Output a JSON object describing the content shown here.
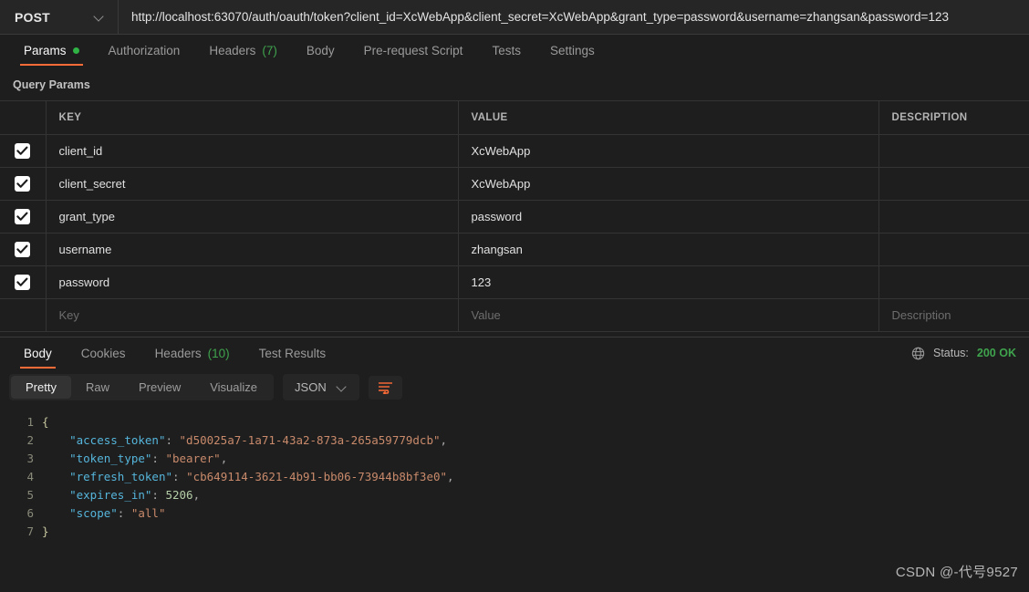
{
  "urlbar": {
    "method": "POST",
    "url": "http://localhost:63070/auth/oauth/token?client_id=XcWebApp&client_secret=XcWebApp&grant_type=password&username=zhangsan&password=123"
  },
  "request_tabs": [
    {
      "label": "Params",
      "badge": "",
      "active": true,
      "dot": true
    },
    {
      "label": "Authorization",
      "badge": "",
      "active": false,
      "dot": false
    },
    {
      "label": "Headers",
      "badge": "(7)",
      "active": false,
      "dot": false
    },
    {
      "label": "Body",
      "badge": "",
      "active": false,
      "dot": false
    },
    {
      "label": "Pre-request Script",
      "badge": "",
      "active": false,
      "dot": false
    },
    {
      "label": "Tests",
      "badge": "",
      "active": false,
      "dot": false
    },
    {
      "label": "Settings",
      "badge": "",
      "active": false,
      "dot": false
    }
  ],
  "query_params": {
    "section_title": "Query Params",
    "columns": [
      "KEY",
      "VALUE",
      "DESCRIPTION"
    ],
    "rows": [
      {
        "checked": true,
        "key": "client_id",
        "value": "XcWebApp",
        "description": ""
      },
      {
        "checked": true,
        "key": "client_secret",
        "value": "XcWebApp",
        "description": ""
      },
      {
        "checked": true,
        "key": "grant_type",
        "value": "password",
        "description": ""
      },
      {
        "checked": true,
        "key": "username",
        "value": "zhangsan",
        "description": ""
      },
      {
        "checked": true,
        "key": "password",
        "value": "123",
        "description": ""
      }
    ],
    "placeholder_row": {
      "key": "Key",
      "value": "Value",
      "description": "Description"
    }
  },
  "response": {
    "tabs": [
      {
        "label": "Body",
        "badge": "",
        "active": true
      },
      {
        "label": "Cookies",
        "badge": "",
        "active": false
      },
      {
        "label": "Headers",
        "badge": "(10)",
        "active": false
      },
      {
        "label": "Test Results",
        "badge": "",
        "active": false
      }
    ],
    "status_label": "Status:",
    "status_value": "200 OK",
    "status_color": "#3fa34d",
    "format_tabs": [
      {
        "label": "Pretty",
        "active": true
      },
      {
        "label": "Raw",
        "active": false
      },
      {
        "label": "Preview",
        "active": false
      },
      {
        "label": "Visualize",
        "active": false
      }
    ],
    "language": "JSON",
    "body_lines": [
      {
        "n": "1",
        "segments": [
          {
            "t": "{",
            "c": "brace"
          }
        ]
      },
      {
        "n": "2",
        "segments": [
          {
            "t": "    ",
            "c": "punc"
          },
          {
            "t": "\"access_token\"",
            "c": "key"
          },
          {
            "t": ": ",
            "c": "punc"
          },
          {
            "t": "\"d50025a7-1a71-43a2-873a-265a59779dcb\"",
            "c": "str"
          },
          {
            "t": ",",
            "c": "punc"
          }
        ]
      },
      {
        "n": "3",
        "segments": [
          {
            "t": "    ",
            "c": "punc"
          },
          {
            "t": "\"token_type\"",
            "c": "key"
          },
          {
            "t": ": ",
            "c": "punc"
          },
          {
            "t": "\"bearer\"",
            "c": "str"
          },
          {
            "t": ",",
            "c": "punc"
          }
        ]
      },
      {
        "n": "4",
        "segments": [
          {
            "t": "    ",
            "c": "punc"
          },
          {
            "t": "\"refresh_token\"",
            "c": "key"
          },
          {
            "t": ": ",
            "c": "punc"
          },
          {
            "t": "\"cb649114-3621-4b91-bb06-73944b8bf3e0\"",
            "c": "str"
          },
          {
            "t": ",",
            "c": "punc"
          }
        ]
      },
      {
        "n": "5",
        "segments": [
          {
            "t": "    ",
            "c": "punc"
          },
          {
            "t": "\"expires_in\"",
            "c": "key"
          },
          {
            "t": ": ",
            "c": "punc"
          },
          {
            "t": "5206",
            "c": "num"
          },
          {
            "t": ",",
            "c": "punc"
          }
        ]
      },
      {
        "n": "6",
        "segments": [
          {
            "t": "    ",
            "c": "punc"
          },
          {
            "t": "\"scope\"",
            "c": "key"
          },
          {
            "t": ": ",
            "c": "punc"
          },
          {
            "t": "\"all\"",
            "c": "str"
          }
        ]
      },
      {
        "n": "7",
        "segments": [
          {
            "t": "}",
            "c": "brace"
          }
        ]
      }
    ],
    "body_json": {
      "access_token": "d50025a7-1a71-43a2-873a-265a59779dcb",
      "token_type": "bearer",
      "refresh_token": "cb649114-3621-4b91-bb06-73944b8bf3e0",
      "expires_in": 5206,
      "scope": "all"
    }
  },
  "watermark": "CSDN @-代号9527",
  "icons": {
    "chevron": "chevron-down-icon",
    "globe": "globe-icon",
    "wrap": "word-wrap-icon",
    "check": "check-icon"
  }
}
